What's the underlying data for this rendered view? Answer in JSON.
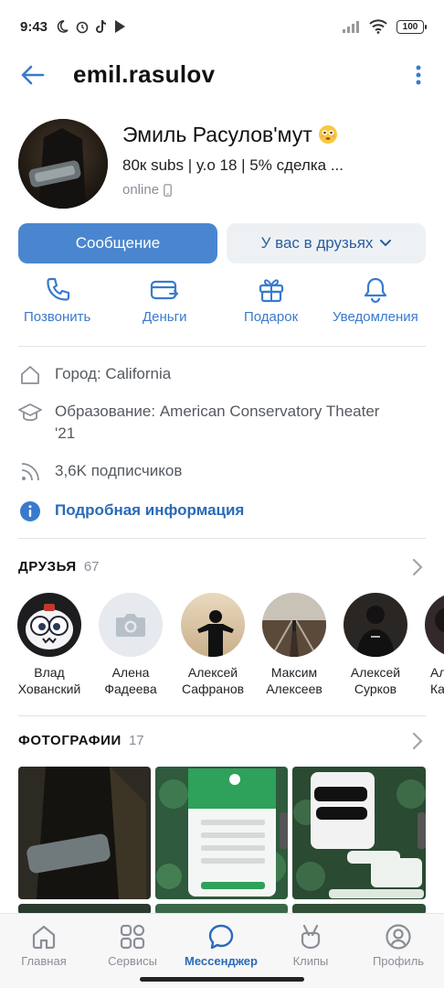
{
  "statusbar": {
    "time": "9:43",
    "battery": "100"
  },
  "header": {
    "title": "emil.rasulov"
  },
  "profile": {
    "name": "Эмиль Расулов'мут",
    "status": "80к subs | у.о 18 | 5% сделка ...",
    "online": "online"
  },
  "buttons": {
    "message": "Сообщение",
    "friends": "У вас в друзьях"
  },
  "actions": [
    {
      "label": "Позвонить",
      "icon": "phone-icon"
    },
    {
      "label": "Деньги",
      "icon": "money-card-icon"
    },
    {
      "label": "Подарок",
      "icon": "gift-icon"
    },
    {
      "label": "Уведомления",
      "icon": "bell-icon"
    }
  ],
  "info": {
    "city": "Город: California",
    "education_line1": "Образование: American Conservatory Theater",
    "education_line2": "'21",
    "followers": "3,6K подписчиков",
    "more": "Подробная информация"
  },
  "friends": {
    "title": "ДРУЗЬЯ",
    "count": "67",
    "items": [
      {
        "line1": "Влад",
        "line2": "Хованский"
      },
      {
        "line1": "Алена",
        "line2": "Фадеева"
      },
      {
        "line1": "Алексей",
        "line2": "Сафранов"
      },
      {
        "line1": "Максим",
        "line2": "Алексеев"
      },
      {
        "line1": "Алексей",
        "line2": "Сурков"
      },
      {
        "line1": "Ал",
        "line2": "Ка"
      }
    ]
  },
  "photos": {
    "title": "ФОТОГРАФИИ",
    "count": "17"
  },
  "tabbar": [
    {
      "label": "Главная",
      "icon": "home-icon"
    },
    {
      "label": "Сервисы",
      "icon": "services-icon"
    },
    {
      "label": "Мессенджер",
      "icon": "messenger-icon",
      "active": true
    },
    {
      "label": "Клипы",
      "icon": "clips-icon"
    },
    {
      "label": "Профиль",
      "icon": "profile-icon"
    }
  ],
  "colors": {
    "accent": "#4a86cf",
    "link": "#2a6ab8",
    "muted": "#8a8f96"
  }
}
